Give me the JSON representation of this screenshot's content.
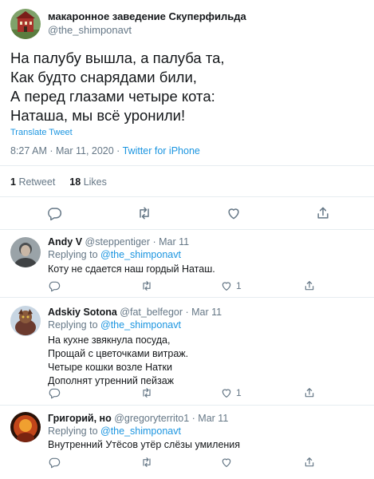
{
  "main_tweet": {
    "author_name": "макаронное заведение Скуперфильда",
    "author_handle": "@the_shimponavt",
    "text": "На палубу вышла, а палуба та,\nКак будто снарядами били,\nА перед глазами четыре кота:\nНаташа, мы всё уронили!",
    "translate_label": "Translate Tweet",
    "time": "8:27 AM · Mar 11, 2020 · ",
    "source": "Twitter for iPhone",
    "retweets_count": "1",
    "retweets_label": "Retweet",
    "likes_count": "18",
    "likes_label": "Likes"
  },
  "replies": [
    {
      "name": "Andy V",
      "handle_date": " @steppentiger · Mar 11",
      "replying_label": "Replying to ",
      "mention": "@the_shimponavt",
      "text": "Коту не сдается наш гордый Наташ.",
      "like_count": "1"
    },
    {
      "name": "Adskiy Sotona",
      "handle_date": " @fat_belfegor · Mar 11",
      "replying_label": "Replying to ",
      "mention": "@the_shimponavt",
      "text": "На кухне звякнула посуда,\nПрощай с цветочками витраж.\nЧетыре кошки возле Натки\nДополнят утренний пейзаж",
      "like_count": "1"
    },
    {
      "name": "Григорий, но",
      "handle_date": " @gregoryterrito1 · Mar 11",
      "replying_label": "Replying to ",
      "mention": "@the_shimponavt",
      "text": "Внутренний Утёсов утёр слёзы умиления",
      "like_count": ""
    }
  ],
  "icons": [
    "reply-icon",
    "retweet-icon",
    "like-icon",
    "share-icon"
  ],
  "colors": {
    "link": "#1b95e0",
    "secondary": "#657786",
    "border": "#e6ecf0",
    "text": "#14171a"
  }
}
